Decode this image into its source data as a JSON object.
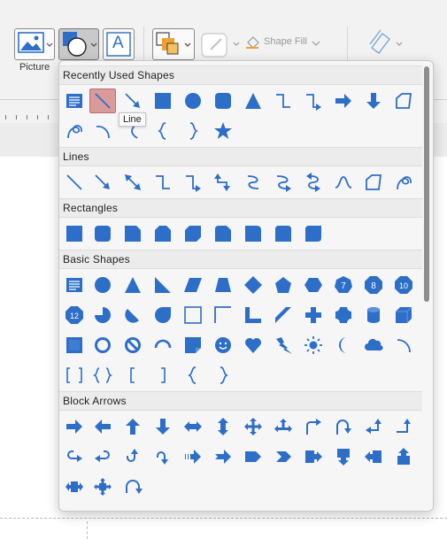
{
  "ribbon": {
    "picture_label": "Picture",
    "shape_fill_label": "Shape Fill",
    "textbox_glyph": "A"
  },
  "gallery": {
    "tooltip": "Line",
    "sections": [
      {
        "title": "Recently Used Shapes"
      },
      {
        "title": "Lines"
      },
      {
        "title": "Rectangles"
      },
      {
        "title": "Basic Shapes"
      },
      {
        "title": "Block Arrows"
      }
    ],
    "octagon_numbers": [
      "7",
      "8",
      "10",
      "12"
    ]
  },
  "colors": {
    "shape_blue": "#2d6ec9",
    "selected_highlight": "#d99a9a",
    "orange_accent": "#f0a030"
  }
}
